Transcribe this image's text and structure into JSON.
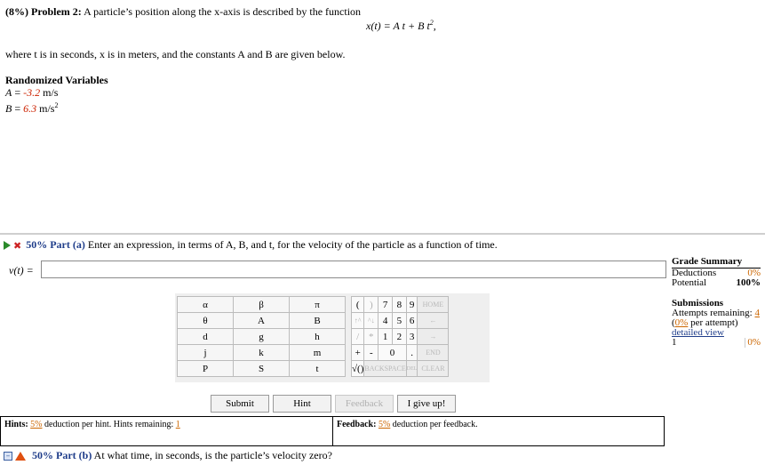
{
  "problem": {
    "weight": "(8%)",
    "title": "Problem 2:",
    "statement": "A particle’s position along the x-axis is described by the function",
    "equation_lhs": "x(t) = ",
    "equation_rhs_a": "A t",
    "equation_plus": " + ",
    "equation_rhs_b": "B t",
    "equation_exp": "2",
    "equation_end": ",",
    "where_text": "where t is in seconds, x is in meters, and the constants A and B are given below."
  },
  "randomized": {
    "title": "Randomized Variables",
    "a_name": "A",
    "a_eq": " = ",
    "a_value": "-3.2",
    "a_unit": " m/s",
    "b_name": "B",
    "b_eq": " = ",
    "b_value": "6.3",
    "b_unit": " m/s",
    "b_unit_exp": "2"
  },
  "part_a": {
    "percent": "50% Part (a)",
    "prompt": "Enter an expression, in terms of A, B, and t, for the velocity of the particle as a function of time.",
    "answer_label": "v(t) = ",
    "answer_value": ""
  },
  "grade_summary": {
    "title": "Grade Summary",
    "deductions_label": "Deductions",
    "deductions_value": "0%",
    "potential_label": "Potential",
    "potential_value": "100%"
  },
  "submissions": {
    "title": "Submissions",
    "attempts_label": "Attempts remaining: ",
    "attempts_value": "4",
    "per_attempt_value": "0%",
    "per_attempt_label": " per attempt)",
    "detailed_view": "detailed view",
    "row_num": "1",
    "row_pct": "0%"
  },
  "keypad": {
    "vars": [
      [
        "α",
        "β",
        "π"
      ],
      [
        "θ",
        "A",
        "B"
      ],
      [
        "d",
        "g",
        "h"
      ],
      [
        "j",
        "k",
        "m"
      ],
      [
        "P",
        "S",
        "t"
      ]
    ],
    "nums": [
      [
        "(",
        ")",
        "7",
        "8",
        "9",
        "HOME"
      ],
      [
        "↑^",
        "^↓",
        "4",
        "5",
        "6",
        "←"
      ],
      [
        "/",
        "*",
        "1",
        "2",
        "3",
        "→"
      ],
      [
        "+",
        "-",
        "0",
        ".",
        "END"
      ],
      [
        "√()",
        "BACKSPACE",
        "DEL",
        "CLEAR"
      ]
    ]
  },
  "buttons": {
    "submit": "Submit",
    "hint": "Hint",
    "feedback": "Feedback",
    "give_up": "I give up!"
  },
  "hints": {
    "label": "Hints: ",
    "pct": "5%",
    "text": " deduction per hint. Hints remaining: ",
    "remaining": "1"
  },
  "feedback": {
    "label": "Feedback: ",
    "pct": "5%",
    "text": " deduction per feedback."
  },
  "part_b": {
    "percent": "50% Part (b)",
    "prompt": "At what time, in seconds, is the particle’s velocity zero?"
  }
}
